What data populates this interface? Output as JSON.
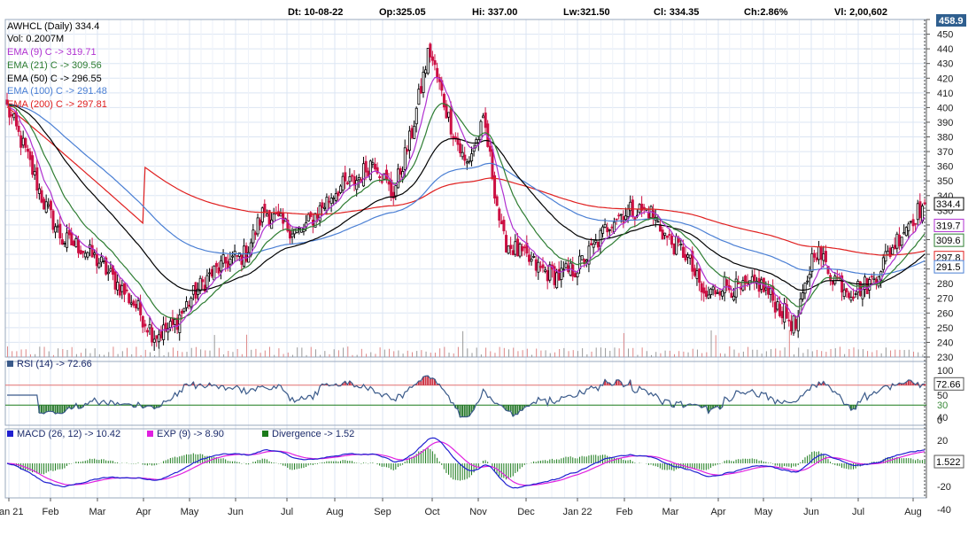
{
  "header": {
    "date": "Dt: 10-08-22",
    "open": "Op:325.05",
    "high": "Hi: 337.00",
    "low": "Lw:321.50",
    "close": "Cl: 334.35",
    "change": "Ch:2.86%",
    "volume": "Vl: 2,00,602"
  },
  "price_pane": {
    "title": "AWHCL (Daily) 334.4",
    "volume_label": "Vol: 0.2007M",
    "legend": [
      {
        "text": "EMA (9) C -> 319.71",
        "color": "#b030d0"
      },
      {
        "text": "EMA (21) C -> 309.56",
        "color": "#2e7d32"
      },
      {
        "text": "EMA (50) C -> 296.55",
        "color": "#000000"
      },
      {
        "text": "EMA (100) C -> 291.48",
        "color": "#4a7fd4"
      },
      {
        "text": "EMA (200) C -> 297.81",
        "color": "#e02020"
      }
    ],
    "y_ticks": [
      "460",
      "450",
      "440",
      "430",
      "420",
      "410",
      "400",
      "390",
      "380",
      "370",
      "360",
      "350",
      "340",
      "330",
      "320",
      "310",
      "300",
      "290",
      "280",
      "270",
      "260",
      "250",
      "240",
      "230"
    ],
    "top_marker": "458.9",
    "markers": [
      {
        "text": "334.4",
        "value": 334.4,
        "color": "#000000"
      },
      {
        "text": "319.7",
        "value": 319.7,
        "color": "#b030d0"
      },
      {
        "text": "309.6",
        "value": 309.6,
        "color": "#2e7d32"
      },
      {
        "text": "297.8",
        "value": 297.8,
        "color": "#e02020"
      },
      {
        "text": "291.5",
        "value": 291.5,
        "color": "#4a7fd4"
      }
    ]
  },
  "rsi_pane": {
    "legend": "RSI (14) -> 72.66",
    "y_ticks": [
      "100",
      "70",
      "50",
      "30",
      "0"
    ],
    "marker": "72.66"
  },
  "macd_pane": {
    "legend_macd": "MACD (26, 12) -> 10.42",
    "legend_exp": "EXP (9) -> 8.90",
    "legend_div": "Divergence -> 1.52",
    "y_ticks": [
      "40",
      "20",
      "0",
      "-20",
      "-40"
    ],
    "marker": "1.522"
  },
  "x_axis": [
    "Jan 21",
    "Feb",
    "Mar",
    "Apr",
    "May",
    "Jun",
    "Jul",
    "Aug",
    "Sep",
    "Oct",
    "Nov",
    "Dec",
    "Jan 22",
    "Feb",
    "Mar",
    "Apr",
    "May",
    "Jun",
    "Jul",
    "Aug"
  ],
  "colors": {
    "up": "#000000",
    "down": "#cc1144",
    "ema9": "#b030d0",
    "ema21": "#2e7d32",
    "ema50": "#000000",
    "ema100": "#4a7fd4",
    "ema200": "#e02020",
    "grid": "#dbe5f3",
    "rsi": "#3a5a8a",
    "macd": "#2020d0",
    "signal": "#e020e0",
    "divergence": "#1a7a1a"
  },
  "chart_data": {
    "type": "candlestick",
    "symbol": "AWHCL",
    "interval": "Daily",
    "ylim": [
      230,
      460
    ],
    "months": [
      "Jan 21",
      "Feb",
      "Mar",
      "Apr",
      "May",
      "Jun",
      "Jul",
      "Aug",
      "Sep",
      "Oct",
      "Nov",
      "Dec",
      "Jan 22",
      "Feb",
      "Mar",
      "Apr",
      "May",
      "Jun",
      "Jul",
      "Aug"
    ],
    "close_path": [
      [
        "Jan 21",
        400
      ],
      [
        "Jan 21",
        370
      ],
      [
        "Feb",
        335
      ],
      [
        "Feb",
        310
      ],
      [
        "Feb",
        305
      ],
      [
        "Mar",
        295
      ],
      [
        "Mar",
        280
      ],
      [
        "Mar",
        265
      ],
      [
        "Apr",
        245
      ],
      [
        "Apr",
        250
      ],
      [
        "May",
        270
      ],
      [
        "May",
        285
      ],
      [
        "May",
        295
      ],
      [
        "Jun",
        300
      ],
      [
        "Jun",
        330
      ],
      [
        "Jun",
        320
      ],
      [
        "Jul",
        315
      ],
      [
        "Jul",
        330
      ],
      [
        "Jul",
        345
      ],
      [
        "Aug",
        350
      ],
      [
        "Aug",
        365
      ],
      [
        "Aug",
        340
      ],
      [
        "Sep",
        380
      ],
      [
        "Sep",
        440
      ],
      [
        "Sep",
        395
      ],
      [
        "Oct",
        360
      ],
      [
        "Oct",
        390
      ],
      [
        "Oct",
        310
      ],
      [
        "Nov",
        300
      ],
      [
        "Nov",
        290
      ],
      [
        "Dec",
        285
      ],
      [
        "Dec",
        290
      ],
      [
        "Jan 22",
        305
      ],
      [
        "Jan 22",
        325
      ],
      [
        "Jan 22",
        330
      ],
      [
        "Feb",
        330
      ],
      [
        "Feb",
        310
      ],
      [
        "Feb",
        300
      ],
      [
        "Mar",
        270
      ],
      [
        "Mar",
        280
      ],
      [
        "Apr",
        275
      ],
      [
        "Apr",
        280
      ],
      [
        "May",
        265
      ],
      [
        "May",
        250
      ],
      [
        "Jun",
        305
      ],
      [
        "Jun",
        285
      ],
      [
        "Jun",
        275
      ],
      [
        "Jul",
        280
      ],
      [
        "Jul",
        300
      ],
      [
        "Aug",
        320
      ],
      [
        "Aug",
        334.35
      ]
    ],
    "last_close": 334.35,
    "ema": {
      "ema9": 319.71,
      "ema21": 309.56,
      "ema50": 296.55,
      "ema100": 291.48,
      "ema200": 297.81
    },
    "volume_last": "0.2007M",
    "rsi": {
      "period": 14,
      "last": 72.66,
      "levels": [
        70,
        50,
        30
      ]
    },
    "macd": {
      "slow": 26,
      "fast": 12,
      "signal": 9,
      "macd": 10.42,
      "exp": 8.9,
      "divergence": 1.52,
      "ylim": [
        -40,
        40
      ]
    }
  }
}
